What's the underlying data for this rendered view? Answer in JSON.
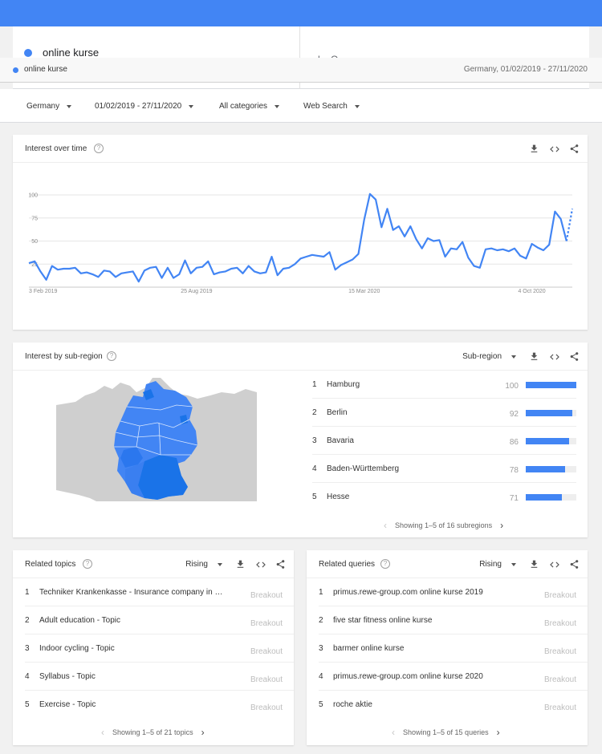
{
  "term": {
    "name": "online kurse",
    "color": "#4285f4",
    "next_term_partial": "l... O..."
  },
  "sticky": {
    "term": "online kurse",
    "meta": "Germany, 01/02/2019 - 27/11/2020"
  },
  "filters": {
    "region": "Germany",
    "date_range": "01/02/2019 - 27/11/2020",
    "category": "All categories",
    "search_type": "Web Search"
  },
  "interest_over_time": {
    "title": "Interest over time",
    "chart_data": {
      "type": "line",
      "title": "",
      "xlabel": "",
      "ylabel": "",
      "x_tick_labels": [
        "3 Feb 2019",
        "25 Aug 2019",
        "15 Mar 2020",
        "4 Oct 2020"
      ],
      "y_tick_labels": [
        "100",
        "75",
        "50",
        "25"
      ],
      "ylim": [
        0,
        100
      ],
      "grid": true,
      "series": [
        {
          "color": "#4285f4",
          "values": [
            26,
            28,
            17,
            8,
            23,
            19,
            20,
            20,
            21,
            15,
            16,
            14,
            11,
            18,
            17,
            11,
            15,
            16,
            17,
            6,
            18,
            21,
            22,
            10,
            21,
            10,
            14,
            29,
            15,
            21,
            22,
            28,
            14,
            16,
            17,
            20,
            21,
            15,
            23,
            17,
            15,
            16,
            33,
            13,
            20,
            21,
            25,
            31,
            33,
            35,
            34,
            33,
            38,
            19,
            24,
            27,
            30,
            36,
            73,
            101,
            95,
            65,
            85,
            62,
            66,
            55,
            66,
            52,
            42,
            53,
            50,
            51,
            33,
            42,
            41,
            49,
            32,
            23,
            21,
            41,
            42,
            40,
            41,
            39,
            42,
            34,
            31,
            47,
            43,
            40,
            46,
            82,
            74,
            50
          ],
          "partial_values": [
            50,
            85
          ]
        }
      ]
    }
  },
  "subregion": {
    "title": "Interest by sub-region",
    "dropdown": "Sub-region",
    "map_colors": {
      "land": "#cfcfcf",
      "water": "#ffffff",
      "region_low": "#4285f4",
      "region_high": "#1a73e8"
    },
    "rows": [
      {
        "rank": "1",
        "name": "Hamburg",
        "value": 100
      },
      {
        "rank": "2",
        "name": "Berlin",
        "value": 92
      },
      {
        "rank": "3",
        "name": "Bavaria",
        "value": 86
      },
      {
        "rank": "4",
        "name": "Baden-Württemberg",
        "value": 78
      },
      {
        "rank": "5",
        "name": "Hesse",
        "value": 71
      }
    ],
    "pager": "Showing 1–5 of 16 subregions"
  },
  "related_topics": {
    "title": "Related topics",
    "dropdown": "Rising",
    "rows": [
      {
        "rank": "1",
        "text": "Techniker Krankenkasse - Insurance company in Germany",
        "badge": "Breakout"
      },
      {
        "rank": "2",
        "text": "Adult education - Topic",
        "badge": "Breakout"
      },
      {
        "rank": "3",
        "text": "Indoor cycling - Topic",
        "badge": "Breakout"
      },
      {
        "rank": "4",
        "text": "Syllabus - Topic",
        "badge": "Breakout"
      },
      {
        "rank": "5",
        "text": "Exercise - Topic",
        "badge": "Breakout"
      }
    ],
    "pager": "Showing 1–5 of 21 topics"
  },
  "related_queries": {
    "title": "Related queries",
    "dropdown": "Rising",
    "rows": [
      {
        "rank": "1",
        "text": "primus.rewe-group.com online kurse 2019",
        "badge": "Breakout"
      },
      {
        "rank": "2",
        "text": "five star fitness online kurse",
        "badge": "Breakout"
      },
      {
        "rank": "3",
        "text": "barmer online kurse",
        "badge": "Breakout"
      },
      {
        "rank": "4",
        "text": "primus.rewe-group.com online kurse 2020",
        "badge": "Breakout"
      },
      {
        "rank": "5",
        "text": "roche aktie",
        "badge": "Breakout"
      }
    ],
    "pager": "Showing 1–5 of 15 queries"
  }
}
